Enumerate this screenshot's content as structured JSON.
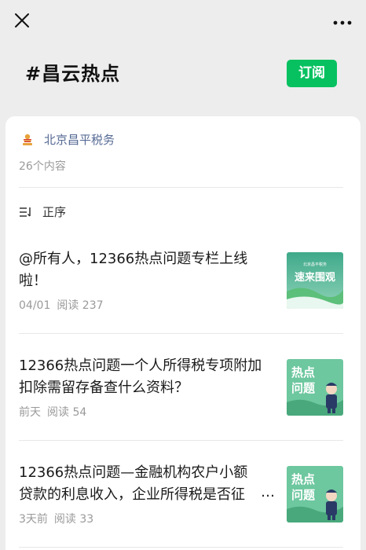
{
  "header": {
    "tag_title": "#昌云热点",
    "subscribe_label": "订阅"
  },
  "account": {
    "name": "北京昌平税务",
    "content_count": "26个内容"
  },
  "sort": {
    "label": "正序"
  },
  "articles": [
    {
      "title": "@所有人，12366热点问题专栏上线啦！",
      "date": "04/01",
      "reads": "阅读 237",
      "thumb_text": "速来围观",
      "thumb_small_text": "北京昌平税务"
    },
    {
      "title": "12366热点问题一个人所得税专项附加扣除需留存备查什么资料？",
      "date": "前天",
      "reads": "阅读 54",
      "thumb_text_1": "热点",
      "thumb_text_2": "问题"
    },
    {
      "title": "12366热点问题—金融机构农户小额贷款的利息收入，企业所得税是否征",
      "title_ellipsis": "…",
      "date": "3天前",
      "reads": "阅读 33",
      "thumb_text_1": "热点",
      "thumb_text_2": "问题"
    }
  ],
  "colors": {
    "accent_green": "#07c160",
    "account_blue": "#576b95",
    "background": "#ededed"
  },
  "icons": [
    "close-icon",
    "more-icon",
    "account-logo-icon",
    "sort-order-icon"
  ]
}
